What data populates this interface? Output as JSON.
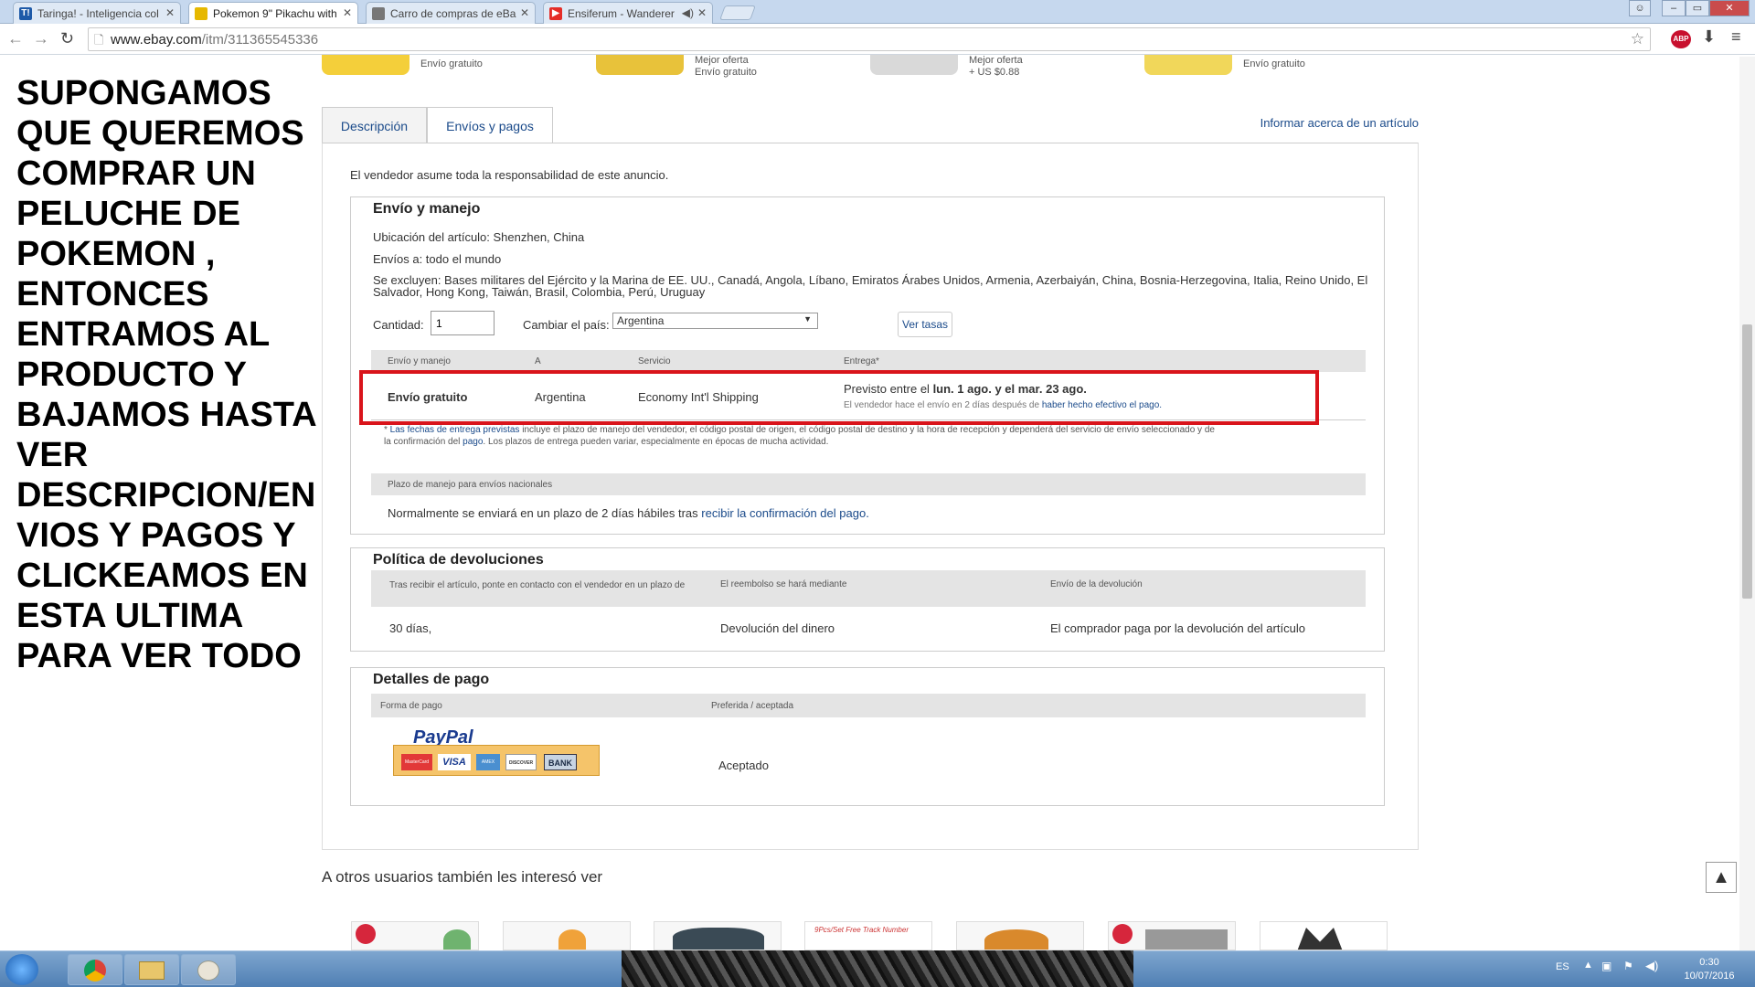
{
  "browser": {
    "tabs": [
      {
        "title": "Taringa! - Inteligencia col",
        "favicon": "T!",
        "favicon_color": "#1e5aa8"
      },
      {
        "title": "Pokemon 9\" Pikachu with",
        "favicon": "",
        "favicon_color": "#e6b800"
      },
      {
        "title": "Carro de compras de eBa",
        "favicon": "",
        "favicon_color": "#777777"
      },
      {
        "title": "Ensiferum - Wanderer",
        "favicon": "▶",
        "favicon_color": "#e52d27"
      }
    ],
    "url_host": "www.ebay.com",
    "url_path": "/itm/311365545336",
    "window_controls": {
      "minimize": "–",
      "maximize": "▭",
      "close": "✕"
    }
  },
  "caption": "SUPONGAMOS QUE QUEREMOS COMPRAR UN PELUCHE DE POKEMON , ENTONCES ENTRAMOS AL PRODUCTO Y BAJAMOS HASTA VER DESCRIPCION/ENVIOS Y PAGOS Y CLICKEAMOS EN ESTA ULTIMA PARA VER TODO",
  "related_strip": [
    {
      "line1": "Envío gratuito",
      "line2": ""
    },
    {
      "line1": "Mejor oferta",
      "line2": "Envío gratuito"
    },
    {
      "line1": "Mejor oferta",
      "line2": "+ US $0.88"
    },
    {
      "line1": "Envío gratuito",
      "line2": ""
    }
  ],
  "page_tabs": {
    "descripcion": "Descripción",
    "envios": "Envíos y pagos",
    "report": "Informar acerca de un artículo"
  },
  "disclaimer": "El vendedor asume toda la responsabilidad de este anuncio.",
  "shipping": {
    "title": "Envío y manejo",
    "location": "Ubicación del artículo: Shenzhen, China",
    "ships_to": "Envíos a: todo el mundo",
    "excludes": "Se excluyen: Bases militares del Ejército y la Marina de EE. UU., Canadá, Angola, Líbano, Emiratos Árabes Unidos, Armenia, Azerbaiyán, China, Bosnia-Herzegovina, Italia, Reino Unido, El Salvador, Hong Kong, Taiwán, Brasil, Colombia, Perú, Uruguay",
    "quantity_label": "Cantidad:",
    "quantity_value": "1",
    "country_label": "Cambiar el país:",
    "country_value": "Argentina",
    "rates_button": "Ver tasas",
    "headers": [
      "Envío y manejo",
      "A",
      "Servicio",
      "Entrega*"
    ],
    "row": {
      "cost": "Envío gratuito",
      "to": "Argentina",
      "service": "Economy Int'l Shipping",
      "delivery_prefix": "Previsto entre el",
      "delivery_dates": "lun. 1 ago. y el mar. 23 ago.",
      "delivery_note_prefix": "El vendedor hace el envío en 2 días después de",
      "delivery_note_link": "haber hecho efectivo el pago."
    },
    "footnote_link": "Las fechas de entrega previstas",
    "footnote_text": "incluye el plazo de manejo del vendedor, el código postal de origen, el código postal de destino y la hora de recepción y dependerá del servicio de envío seleccionado y de",
    "footnote_line2_prefix": "la confirmación del",
    "footnote_line2_link": "pago",
    "footnote_line2_text": ". Los plazos de entrega pueden variar, especialmente en épocas de mucha actividad.",
    "handling_header": "Plazo de manejo para envíos nacionales",
    "handling_text": "Normalmente se enviará en un plazo de 2 días hábiles tras",
    "handling_link": "recibir la confirmación del pago."
  },
  "returns": {
    "title": "Política de devoluciones",
    "headers": [
      "Tras recibir el artículo, ponte en contacto con el vendedor en un plazo de",
      "El reembolso se hará mediante",
      "Envío de la devolución"
    ],
    "values": [
      "30 días,",
      "Devolución del dinero",
      "El comprador paga por la devolución del artículo"
    ]
  },
  "payment": {
    "title": "Detalles de pago",
    "headers": [
      "Forma de pago",
      "Preferida / aceptada"
    ],
    "paypal": "PayPal",
    "cards": [
      "MasterCard",
      "VISA",
      "AMEX",
      "DISCOVER",
      "BANK"
    ],
    "status": "Aceptado"
  },
  "others_title": "A otros usuarios también les interesó ver",
  "recommendations": [
    "",
    "",
    "",
    "9Pcs/Set  Free Track Number",
    "",
    "",
    ""
  ],
  "scroll_top_icon": "▲",
  "taskbar": {
    "lang": "ES",
    "time": "0:30",
    "date": "10/07/2016"
  },
  "colors": {
    "highlight": "#d9141b",
    "link": "#1a4a8a",
    "paypal_bg": "#f5c46a"
  }
}
